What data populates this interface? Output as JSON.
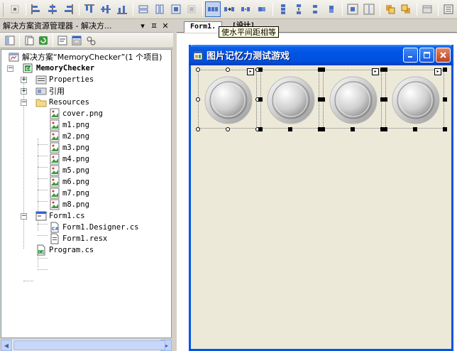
{
  "tooltip": {
    "text": "使水平间距相等"
  },
  "solution_explorer": {
    "title": "解决方案资源管理器 - 解决方...",
    "title_buttons": {
      "dropdown": "▾",
      "pin": "ㅍ",
      "close": "✕"
    },
    "tree": {
      "solution": "解决方案“MemoryChecker”(1 个项目)",
      "project": "MemoryChecker",
      "properties": "Properties",
      "references": "引用",
      "resources": "Resources",
      "resource_files": [
        "cover.png",
        "m1.png",
        "m2.png",
        "m3.png",
        "m4.png",
        "m5.png",
        "m6.png",
        "m7.png",
        "m8.png"
      ],
      "form1": "Form1.cs",
      "form1_children": [
        "Form1.Designer.cs",
        "Form1.resx"
      ],
      "program": "Program.cs"
    }
  },
  "designer": {
    "tab_label": "Form1.",
    "tab2_label": "[设计]",
    "form": {
      "title": "图片记忆力测试游戏",
      "picture_count": 4
    }
  },
  "colors": {
    "title_bar": "#0054e3",
    "selection_border": "#316ac5",
    "tree_border": "#7f9db9"
  }
}
